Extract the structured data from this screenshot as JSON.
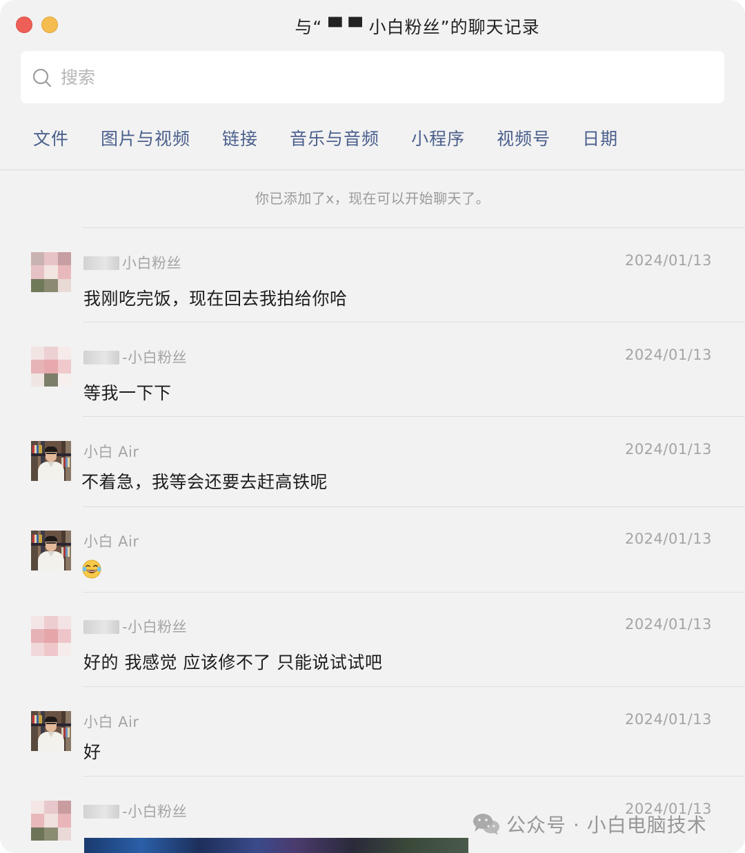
{
  "window": {
    "title": "与“ ▀  ▀ 小白粉丝”的聊天记录"
  },
  "search": {
    "placeholder": "搜索"
  },
  "tabs": [
    {
      "label": "文件"
    },
    {
      "label": "图片与视频"
    },
    {
      "label": "链接"
    },
    {
      "label": "音乐与音频"
    },
    {
      "label": "小程序"
    },
    {
      "label": "视频号"
    },
    {
      "label": "日期"
    }
  ],
  "system_message": "你已添加了x，现在可以开始聊天了。",
  "messages": [
    {
      "sender": "小白粉丝",
      "date": "2024/01/13",
      "text": "我刚吃完饭，现在回去我拍给你哈"
    },
    {
      "sender": "-小白粉丝",
      "date": "2024/01/13",
      "text": "等我一下下"
    },
    {
      "sender": "小白 Air",
      "date": "2024/01/13",
      "text": "不着急，我等会还要去赶高铁呢"
    },
    {
      "sender": "小白 Air",
      "date": "2024/01/13",
      "text": ""
    },
    {
      "sender": "-小白粉丝",
      "date": "2024/01/13",
      "text": "好的  我感觉  应该修不了  只能说试试吧"
    },
    {
      "sender": "小白 Air",
      "date": "2024/01/13",
      "text": "好"
    },
    {
      "sender": "-小白粉丝",
      "date": "2024/01/13",
      "text": ""
    }
  ],
  "watermark": {
    "text": "公众号 · 小白电脑技术"
  },
  "colors": {
    "tab_text": "#4a5f8c",
    "window_bg": "#f2f2f2",
    "close": "#ee5f57",
    "minimize": "#f5bd4f"
  }
}
